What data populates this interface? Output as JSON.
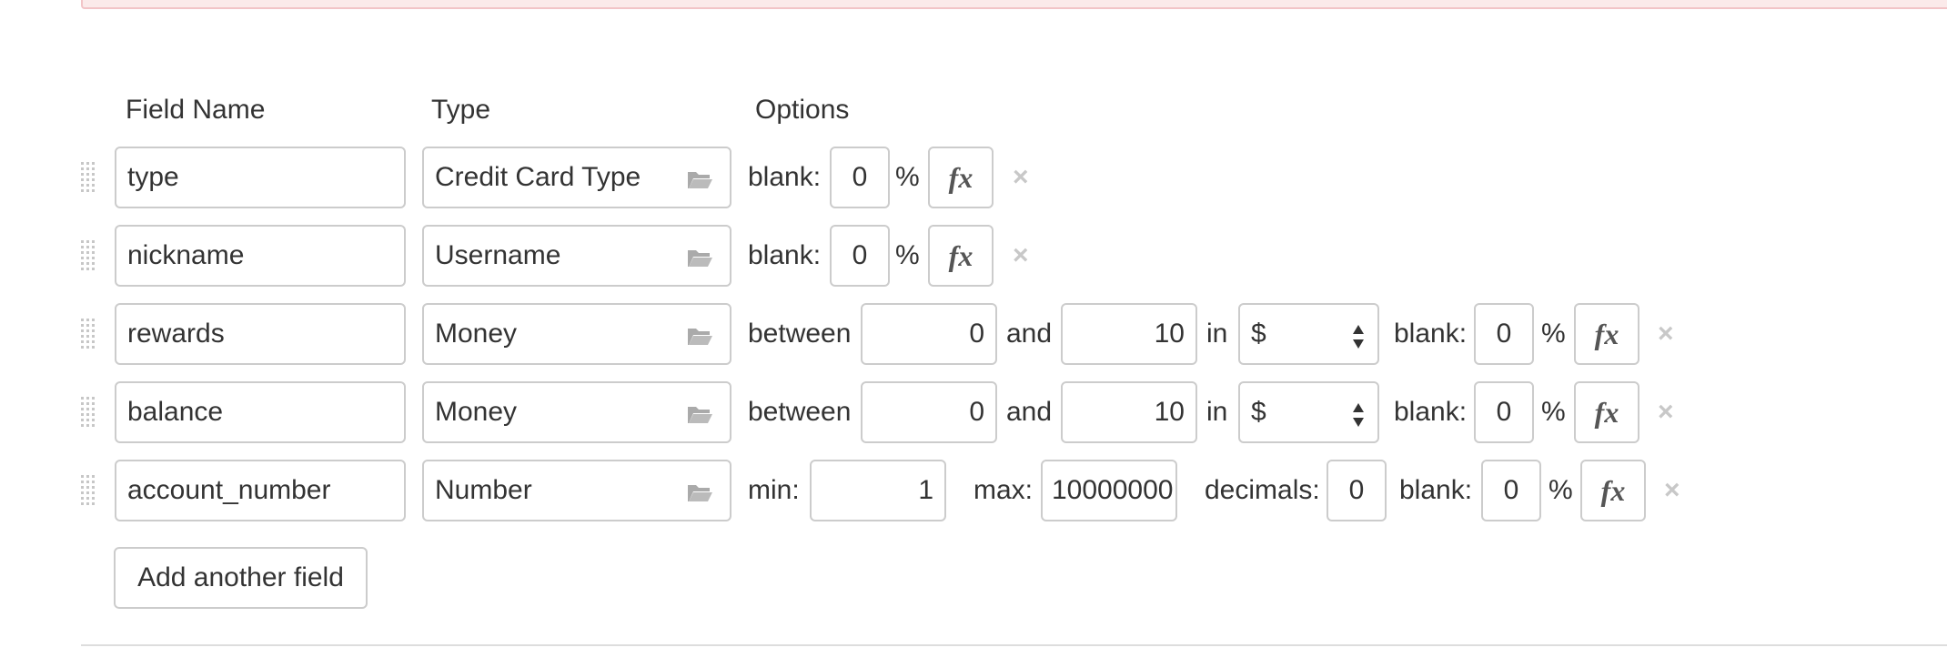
{
  "headers": {
    "field_name": "Field Name",
    "type": "Type",
    "options": "Options"
  },
  "rows": [
    {
      "name": "type",
      "type": "Credit Card Type",
      "blank_label": "blank:",
      "blank": "0",
      "percent": "%",
      "fx": "fx",
      "close": "×"
    },
    {
      "name": "nickname",
      "type": "Username",
      "blank_label": "blank:",
      "blank": "0",
      "percent": "%",
      "fx": "fx",
      "close": "×"
    },
    {
      "name": "rewards",
      "type": "Money",
      "between_label": "between",
      "min": "0",
      "and_label": "and",
      "max": "10",
      "in_label": "in",
      "currency": "$",
      "blank_label": "blank:",
      "blank": "0",
      "percent": "%",
      "fx": "fx",
      "close": "×"
    },
    {
      "name": "balance",
      "type": "Money",
      "between_label": "between",
      "min": "0",
      "and_label": "and",
      "max": "10",
      "in_label": "in",
      "currency": "$",
      "blank_label": "blank:",
      "blank": "0",
      "percent": "%",
      "fx": "fx",
      "close": "×"
    },
    {
      "name": "account_number",
      "type": "Number",
      "min_label": "min:",
      "min": "1",
      "max_label": "max:",
      "max": "10000000",
      "decimals_label": "decimals:",
      "decimals": "0",
      "blank_label": "blank:",
      "blank": "0",
      "percent": "%",
      "fx": "fx",
      "close": "×"
    }
  ],
  "add_button": "Add another field",
  "colors": {
    "alert_bg": "#fbeaea",
    "alert_border": "#f2c4c7",
    "border": "#cccccc",
    "close": "#c8c8c8"
  },
  "icons": {
    "type_picker": "folder-open-icon",
    "drag": "drag-handle-icon",
    "formula": "fx-icon",
    "remove": "close-icon",
    "select": "select-arrows-icon"
  }
}
